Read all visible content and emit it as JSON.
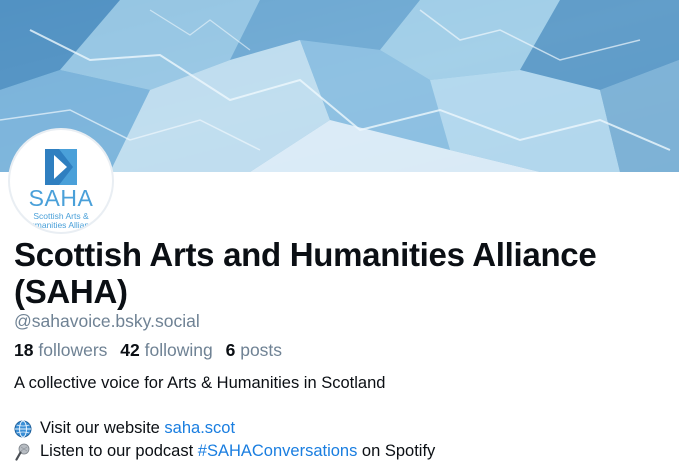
{
  "profile": {
    "display_name": "Scottish Arts and Humanities Alliance (SAHA)",
    "handle": "@sahavoice.bsky.social",
    "stats": {
      "followers_count": "18",
      "followers_label": "followers",
      "following_count": "42",
      "following_label": "following",
      "posts_count": "6",
      "posts_label": "posts"
    },
    "bio": "A collective voice for Arts & Humanities in Scotland",
    "website_line": {
      "icon": "globe-icon",
      "prefix": "Visit our website ",
      "link": "saha.scot"
    },
    "podcast_line": {
      "icon": "microphone-icon",
      "prefix": "Listen to our podcast ",
      "link": "#SAHAConversations",
      "suffix": " on Spotify"
    }
  },
  "avatar": {
    "logo_text": "SAHA",
    "logo_subtitle_1": "Scottish Arts &",
    "logo_subtitle_2": "Humanities Alliance"
  },
  "colors": {
    "link": "#1a7ee0",
    "muted": "#6f8294",
    "logo_blue": "#4aa0d9",
    "banner_ice": "#7fb3d6"
  }
}
